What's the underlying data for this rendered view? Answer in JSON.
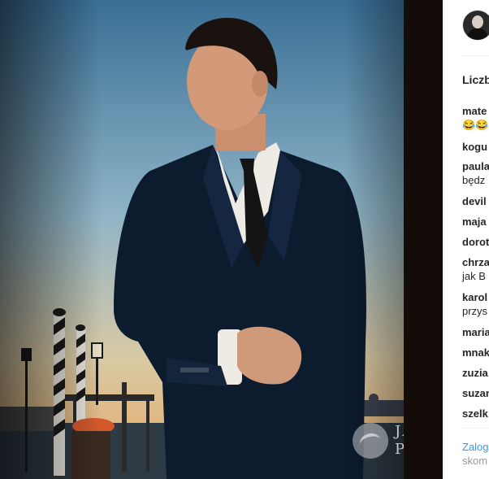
{
  "post": {
    "likes_label": "Liczb",
    "login_label": "Zalog",
    "login_sub": "skom"
  },
  "watermark": {
    "line1": "JASTR",
    "line2": "POST"
  },
  "comments": [
    {
      "user": "mate",
      "text": "😂😂"
    },
    {
      "user": "kogu",
      "text": ""
    },
    {
      "user": "paula",
      "text": "będz"
    },
    {
      "user": "devil",
      "text": ""
    },
    {
      "user": "maja",
      "text": ""
    },
    {
      "user": "doroti",
      "text": ""
    },
    {
      "user": "chrza",
      "text": "jak B"
    },
    {
      "user": "karol",
      "text": "przys"
    },
    {
      "user": "maria",
      "text": ""
    },
    {
      "user": "mnak",
      "text": ""
    },
    {
      "user": "zuzia",
      "text": ""
    },
    {
      "user": "suzan",
      "text": ""
    },
    {
      "user": "szelk",
      "text": ""
    }
  ]
}
